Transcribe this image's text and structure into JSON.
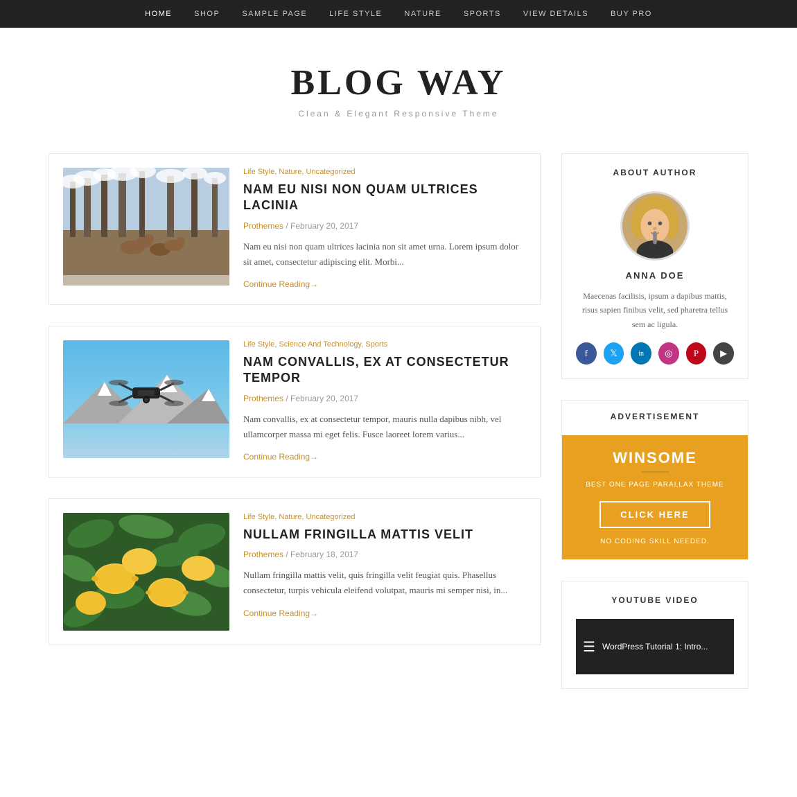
{
  "nav": {
    "items": [
      {
        "label": "HOME",
        "active": true
      },
      {
        "label": "SHOP",
        "active": false
      },
      {
        "label": "SAMPLE PAGE",
        "active": false
      },
      {
        "label": "LIFE STYLE",
        "active": false
      },
      {
        "label": "NATURE",
        "active": false
      },
      {
        "label": "SPORTS",
        "active": false
      },
      {
        "label": "VIEW DETAILS",
        "active": false
      },
      {
        "label": "BUY PRO",
        "active": false
      }
    ]
  },
  "site": {
    "title": "BLOG WAY",
    "tagline": "Clean & Elegant Responsive Theme"
  },
  "articles": [
    {
      "categories": [
        "Life Style",
        "Nature",
        "Uncategorized"
      ],
      "title": "NAM EU NISI NON QUAM ULTRICES LACINIA",
      "author": "Prothemes",
      "date": "February 20, 2017",
      "excerpt": "Nam eu nisi non quam ultrices lacinia non sit amet urna. Lorem ipsum dolor sit amet, consectetur adipiscing elit. Morbi...",
      "continue_label": "Continue Reading→",
      "image_class": "img-deer"
    },
    {
      "categories": [
        "Life Style",
        "Science And Technology",
        "Sports"
      ],
      "title": "NAM CONVALLIS, EX AT CONSECTETUR TEMPOR",
      "author": "Prothemes",
      "date": "February 20, 2017",
      "excerpt": "Nam convallis, ex at consectetur tempor, mauris nulla dapibus nibh, vel ullamcorper massa mi eget felis. Fusce laoreet lorem varius...",
      "continue_label": "Continue Reading→",
      "image_class": "img-drone"
    },
    {
      "categories": [
        "Life Style",
        "Nature",
        "Uncategorized"
      ],
      "title": "NULLAM FRINGILLA MATTIS VELIT",
      "author": "Prothemes",
      "date": "February 18, 2017",
      "excerpt": "Nullam fringilla mattis velit, quis fringilla velit feugiat quis. Phasellus consectetur, turpis vehicula eleifend volutpat, mauris mi semper nisi, in...",
      "continue_label": "Continue Reading→",
      "image_class": "img-lemon"
    }
  ],
  "sidebar": {
    "about": {
      "section_title": "ABOUT AUTHOR",
      "author_name": "ANNA DOE",
      "author_bio": "Maecenas facilisis, ipsum a dapibus mattis, risus sapien finibus velit, sed pharetra tellus sem ac ligula.",
      "social_icons": [
        {
          "name": "facebook-icon",
          "symbol": "f"
        },
        {
          "name": "twitter-icon",
          "symbol": "t"
        },
        {
          "name": "linkedin-icon",
          "symbol": "in"
        },
        {
          "name": "instagram-icon",
          "symbol": "ig"
        },
        {
          "name": "pinterest-icon",
          "symbol": "p"
        },
        {
          "name": "youtube-icon",
          "symbol": "▶"
        }
      ]
    },
    "advertisement": {
      "section_title": "ADVERTISEMENT",
      "product_name": "WINSOME",
      "tagline": "BEST ONE PAGE PARALLAX THEME",
      "button_label": "CLICK HERE",
      "note": "NO CODING SKILL NEEDED."
    },
    "youtube": {
      "section_title": "YOUTUBE VIDEO",
      "thumb_text": "WordPress Tutorial 1: Intro..."
    }
  }
}
